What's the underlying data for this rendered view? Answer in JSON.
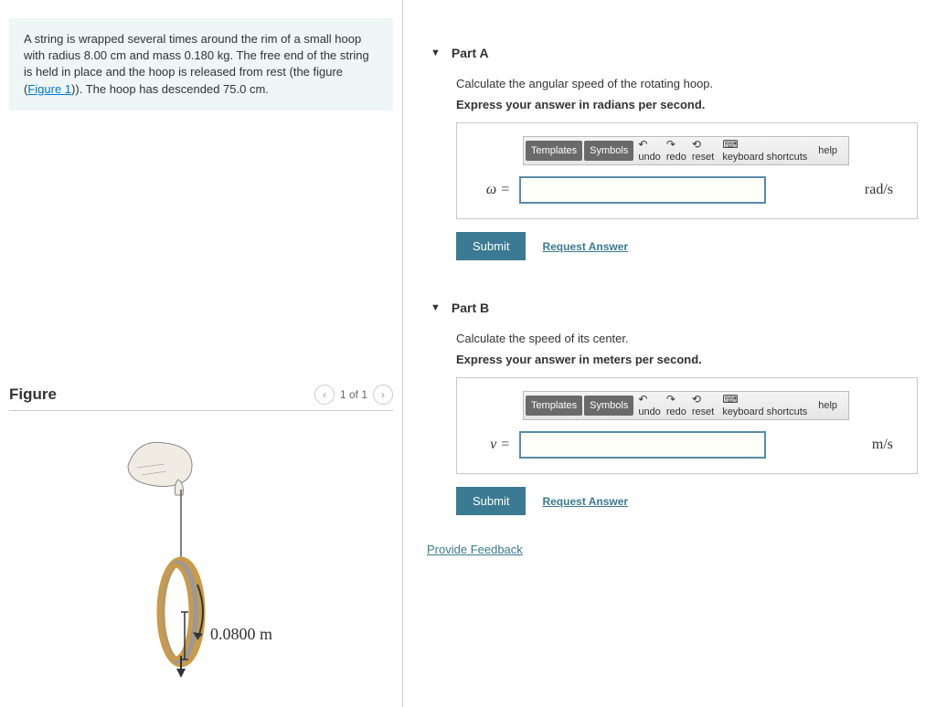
{
  "prompt": {
    "text_before_link": "A string is wrapped several times around the rim of a small hoop with radius 8.00 cm and mass 0.180 kg. The free end of the string is held in place and the hoop is released from rest (the figure (",
    "link_text": "Figure 1",
    "text_after_link": ")). The hoop has descended 75.0 cm."
  },
  "figure": {
    "title": "Figure",
    "nav": "1 of 1",
    "radius_label": "0.0800 m"
  },
  "parts": [
    {
      "title": "Part A",
      "instruction": "Calculate the angular speed of the rotating hoop.",
      "express": "Express your answer in radians per second.",
      "var": "ω =",
      "unit": "rad/s",
      "submit": "Submit",
      "request": "Request Answer"
    },
    {
      "title": "Part B",
      "instruction": "Calculate the speed of its center.",
      "express": "Express your answer in meters per second.",
      "var": "v =",
      "unit": "m/s",
      "submit": "Submit",
      "request": "Request Answer"
    }
  ],
  "toolbar": {
    "templates": "Templates",
    "symbols": "Symbols",
    "undo": "undo",
    "redo": "redo",
    "reset": "reset",
    "keyboard": "keyboard shortcuts",
    "help": "help"
  },
  "feedback": "Provide Feedback"
}
